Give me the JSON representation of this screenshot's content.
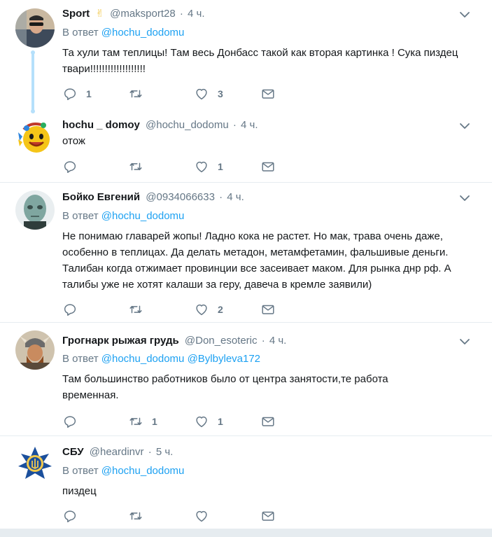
{
  "tweets": [
    {
      "name": "Sport",
      "emoji": "✌",
      "handle": "@maksport28",
      "dot": "·",
      "time": "4 ч.",
      "reply_prefix": "В ответ",
      "reply_to": [
        "@hochu_dodomu"
      ],
      "text": "Та хули там теплицы! Там весь Донбасс такой как вторая картинка ! Сука пиздец твари!!!!!!!!!!!!!!!!!!!",
      "replies": "1",
      "retweets": "",
      "likes": "3"
    },
    {
      "name": "hochu _ domoy",
      "handle": "@hochu_dodomu",
      "dot": "·",
      "time": "4 ч.",
      "text": "отож",
      "replies": "",
      "retweets": "",
      "likes": "1"
    },
    {
      "name": "Бойко Евгений",
      "handle": "@0934066633",
      "dot": "·",
      "time": "4 ч.",
      "reply_prefix": "В ответ",
      "reply_to": [
        "@hochu_dodomu"
      ],
      "text": "Не понимаю главарей жопы! Ладно кока не растет. Но мак, трава очень даже, особенно в теплицах. Да делать метадон, метамфетамин, фальшивые деньги. Талибан когда отжимает провинции все засеивает маком. Для рынка днр рф. А талибы уже не хотят калаши за геру, давеча в кремле заявили)",
      "replies": "",
      "retweets": "",
      "likes": "2"
    },
    {
      "name": "Грогнарк рыжая грудь",
      "handle": "@Don_esoteric",
      "dot": "·",
      "time": "4 ч.",
      "reply_prefix": "В ответ",
      "reply_to": [
        "@hochu_dodomu",
        "@Bylbyleva172"
      ],
      "text": "Там большинство работников было от центра занятости,те работа временная.",
      "replies": "",
      "retweets": "1",
      "likes": "1"
    },
    {
      "name": "СБУ",
      "handle": "@heardinvr",
      "dot": "·",
      "time": "5 ч.",
      "reply_prefix": "В ответ",
      "reply_to": [
        "@hochu_dodomu"
      ],
      "text": "пиздец",
      "replies": "",
      "retweets": "",
      "likes": ""
    }
  ],
  "icons": {
    "reply": "reply-icon",
    "retweet": "retweet-icon",
    "like": "heart-icon",
    "dm": "envelope-icon",
    "more": "chevron-down-icon"
  },
  "colors": {
    "link": "#1da1f2",
    "muted": "#657786",
    "text": "#14171a",
    "separator": "#e6ecf0",
    "thread_line": "#b5e0fb"
  }
}
